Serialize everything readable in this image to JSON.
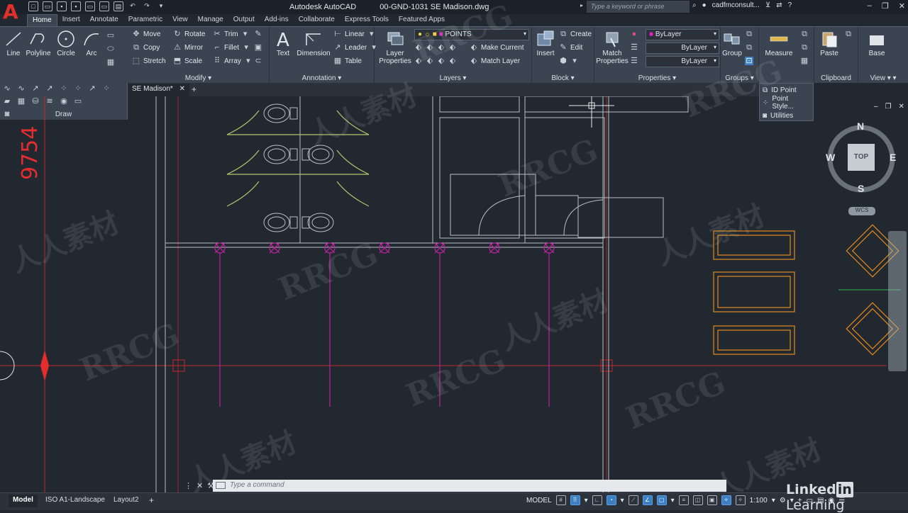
{
  "title_bar": {
    "app_logo": "A",
    "app_name": "Autodesk AutoCAD",
    "file_name": "00-GND-1031 SE Madison.dwg",
    "search_placeholder": "Type a keyword or phrase",
    "user": "cadfmconsult...",
    "help": "?"
  },
  "ribbon_tabs": [
    "Home",
    "Insert",
    "Annotate",
    "Parametric",
    "View",
    "Manage",
    "Output",
    "Add-ins",
    "Collaborate",
    "Express Tools",
    "Featured Apps"
  ],
  "active_tab": "Home",
  "ribbon": {
    "draw": {
      "title": "Draw",
      "line": "Line",
      "polyline": "Polyline",
      "circle": "Circle",
      "arc": "Arc"
    },
    "modify": {
      "title": "Modify",
      "move": "Move",
      "rotate": "Rotate",
      "trim": "Trim",
      "copy": "Copy",
      "mirror": "Mirror",
      "fillet": "Fillet",
      "stretch": "Stretch",
      "scale": "Scale",
      "array": "Array"
    },
    "annotation": {
      "title": "Annotation",
      "text": "Text",
      "dimension": "Dimension",
      "linear": "Linear",
      "leader": "Leader",
      "table": "Table"
    },
    "layers": {
      "title": "Layers",
      "layer_properties_1": "Layer",
      "layer_properties_2": "Properties",
      "current_layer": "POINTS",
      "make_current": "Make Current",
      "match_layer": "Match Layer"
    },
    "block": {
      "title": "Block",
      "insert": "Insert",
      "create": "Create",
      "edit": "Edit"
    },
    "properties": {
      "title": "Properties",
      "match_1": "Match",
      "match_2": "Properties",
      "color": "ByLayer",
      "linetype": "ByLayer",
      "lineweight": "ByLayer"
    },
    "groups": {
      "title": "Groups",
      "group": "Group"
    },
    "utilities": {
      "measure": "Measure"
    },
    "clipboard": {
      "title": "Clipboard",
      "paste": "Paste"
    },
    "view": {
      "title": "View",
      "base": "Base"
    }
  },
  "groups_flyout": [
    "ID Point",
    "Point Style...",
    "Utilities"
  ],
  "doc_tab": "SE Madison*",
  "viewcube": {
    "n": "N",
    "s": "S",
    "e": "E",
    "w": "W",
    "face": "TOP",
    "wcs": "WCS"
  },
  "drawing": {
    "dimension_text": "9754"
  },
  "command_line": {
    "placeholder": "Type a command"
  },
  "status_bar": {
    "layouts": [
      "Model",
      "ISO A1-Landscape",
      "Layout2"
    ],
    "active_layout": "Model",
    "model_label": "MODEL",
    "scale": "1:100"
  },
  "watermarks": {
    "brand": "RRCG",
    "cn": "人人素材"
  },
  "branding": {
    "linkedin": "Linked",
    "in": "in",
    "learning": "Learning"
  },
  "colors": {
    "accent": "#3d7fc2",
    "canvas": "#212830",
    "ribbon": "#3b4551",
    "grid_red": "#c4262b",
    "points": "#c020a0",
    "furniture": "#e08a1e",
    "walls": "#b9bec4"
  }
}
